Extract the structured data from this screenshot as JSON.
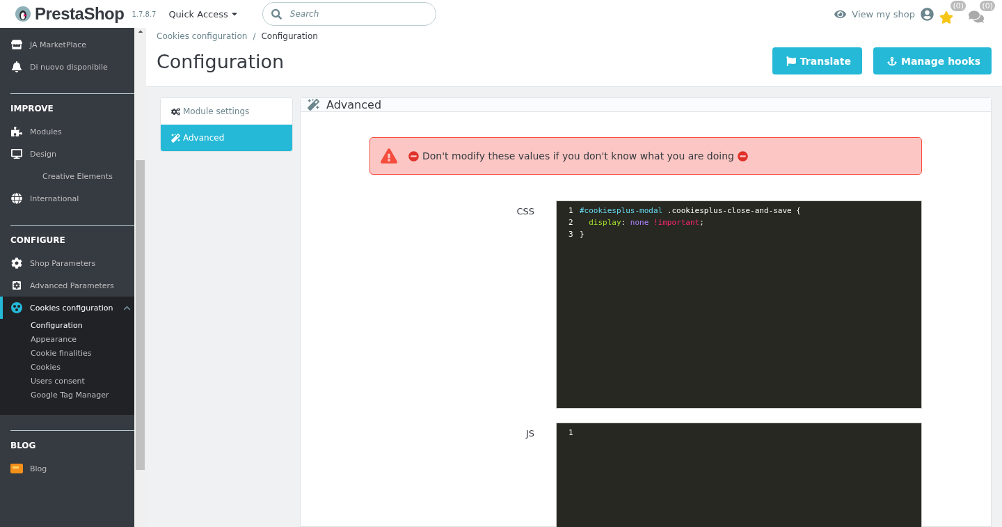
{
  "header": {
    "logo": "PrestaShop",
    "version": "1.7.8.7",
    "quick_access": "Quick Access",
    "search": {
      "placeholder": "Search"
    },
    "view_shop": "View my shop",
    "badges": [
      "(0)",
      "(0)"
    ]
  },
  "sidebar": {
    "sections": [
      {
        "items": [
          {
            "label": "JA MarketPlace",
            "selected": false
          },
          {
            "label": "Di nuovo disponibile",
            "selected": false
          }
        ]
      },
      {
        "title": "IMPROVE",
        "items": [
          {
            "label": "Modules",
            "selected": false
          },
          {
            "label": "Design",
            "selected": false
          },
          {
            "label": "Creative Elements",
            "selected": false
          },
          {
            "label": "International",
            "selected": false
          }
        ]
      },
      {
        "title": "CONFIGURE",
        "items": [
          {
            "label": "Shop Parameters",
            "selected": false
          },
          {
            "label": "Advanced Parameters",
            "selected": false
          },
          {
            "label": "Cookies configuration",
            "selected": true,
            "expanded": true,
            "children": [
              {
                "label": "Configuration",
                "selected": true
              },
              {
                "label": "Appearance",
                "selected": false
              },
              {
                "label": "Cookie finalities",
                "selected": false
              },
              {
                "label": "Cookies",
                "selected": false
              },
              {
                "label": "Users consent",
                "selected": false
              },
              {
                "label": "Google Tag Manager",
                "selected": false
              }
            ]
          }
        ]
      },
      {
        "title": "BLOG",
        "items": [
          {
            "label": "Blog",
            "selected": false
          }
        ]
      }
    ]
  },
  "breadcrumb": {
    "items": [
      "Cookies configuration",
      "Configuration"
    ],
    "separator": "/"
  },
  "page_title": "Configuration",
  "toolbar_buttons": [
    {
      "label": "Translate"
    },
    {
      "label": "Manage hooks"
    }
  ],
  "tabs": [
    {
      "label": "Module settings",
      "selected": false
    },
    {
      "label": "Advanced",
      "selected": true
    }
  ],
  "panel": {
    "title": "Advanced",
    "alert": "Don't modify these values if you don't know what you are doing",
    "fields": [
      {
        "label": "CSS",
        "lines": [
          {
            "number": "1",
            "tokens": [
              {
                "kind": "id",
                "text": "#cookiesplus-modal"
              },
              {
                "kind": "plain",
                "text": " .cookiesplus-close-and-save {"
              }
            ]
          },
          {
            "number": "2",
            "indented": true,
            "tokens": [
              {
                "kind": "property",
                "text": "display"
              },
              {
                "kind": "plain",
                "text": ": "
              },
              {
                "kind": "value",
                "text": "none "
              },
              {
                "kind": "important",
                "text": "!important"
              },
              {
                "kind": "plain",
                "text": ";"
              }
            ]
          },
          {
            "number": "3",
            "tokens": [
              {
                "kind": "plain",
                "text": "}"
              }
            ]
          }
        ]
      },
      {
        "label": "JS",
        "lines": [
          {
            "number": "1"
          }
        ]
      }
    ]
  }
}
